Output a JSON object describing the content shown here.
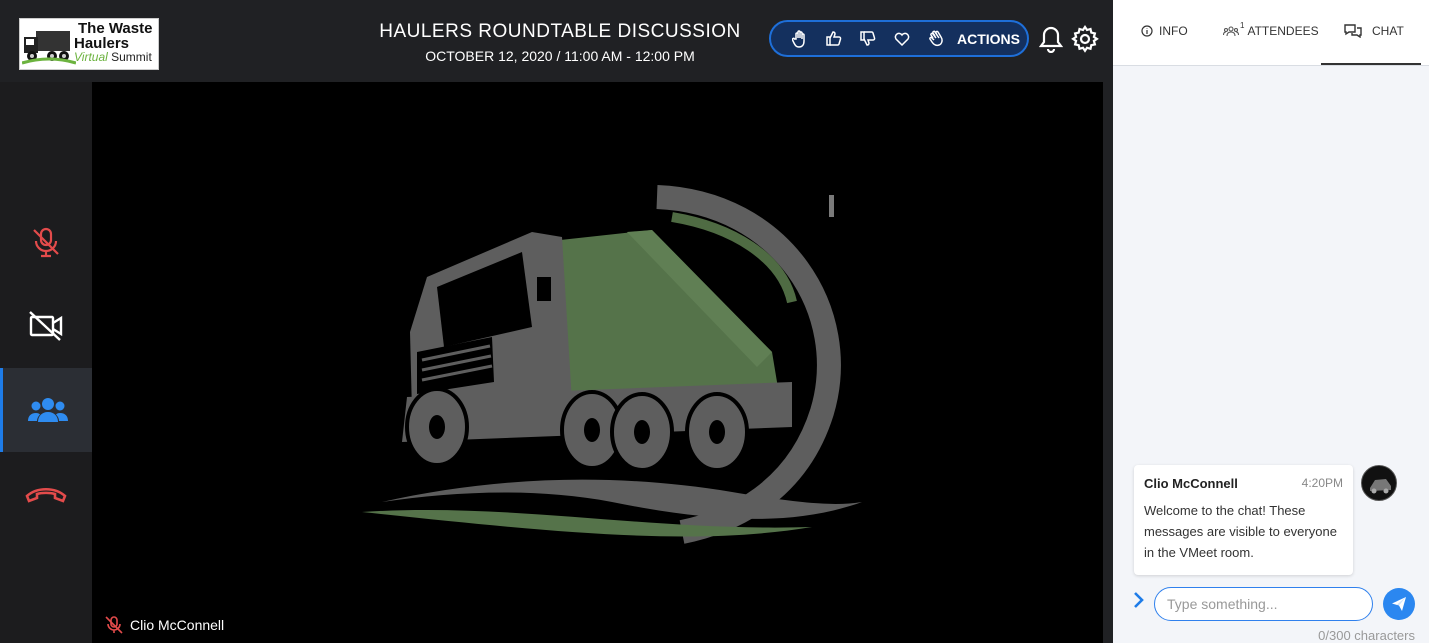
{
  "logo": {
    "line1": "The Waste",
    "line2": "Haulers",
    "line3a": "Virtual",
    "line3b": " Summit"
  },
  "session": {
    "title": "HAULERS ROUNDTABLE DISCUSSION",
    "datetime": "OCTOBER 12, 2020 / 11:00 AM - 12:00 PM"
  },
  "reactions": {
    "items": [
      "raise-hand-icon",
      "thumbs-up-icon",
      "thumbs-down-icon",
      "heart-icon",
      "clap-icon"
    ],
    "actions_label": "ACTIONS"
  },
  "video": {
    "participant_name": "Clio McConnell",
    "participant_muted": true
  },
  "tabs": {
    "info": "INFO",
    "attendees": "ATTENDEES",
    "attendees_count": "1",
    "chat": "CHAT",
    "active": "chat"
  },
  "chat": {
    "messages": [
      {
        "author": "Clio McConnell",
        "time": "4:20PM",
        "text": "Welcome to the chat! These messages are visible to everyone in the VMeet room."
      }
    ],
    "input_placeholder": "Type something...",
    "char_count": "0/300 characters"
  },
  "colors": {
    "accent": "#1e7ce8",
    "danger": "#e34b4b",
    "truck_green": "#5c7a4e",
    "truck_gray": "#5e5e5e"
  }
}
